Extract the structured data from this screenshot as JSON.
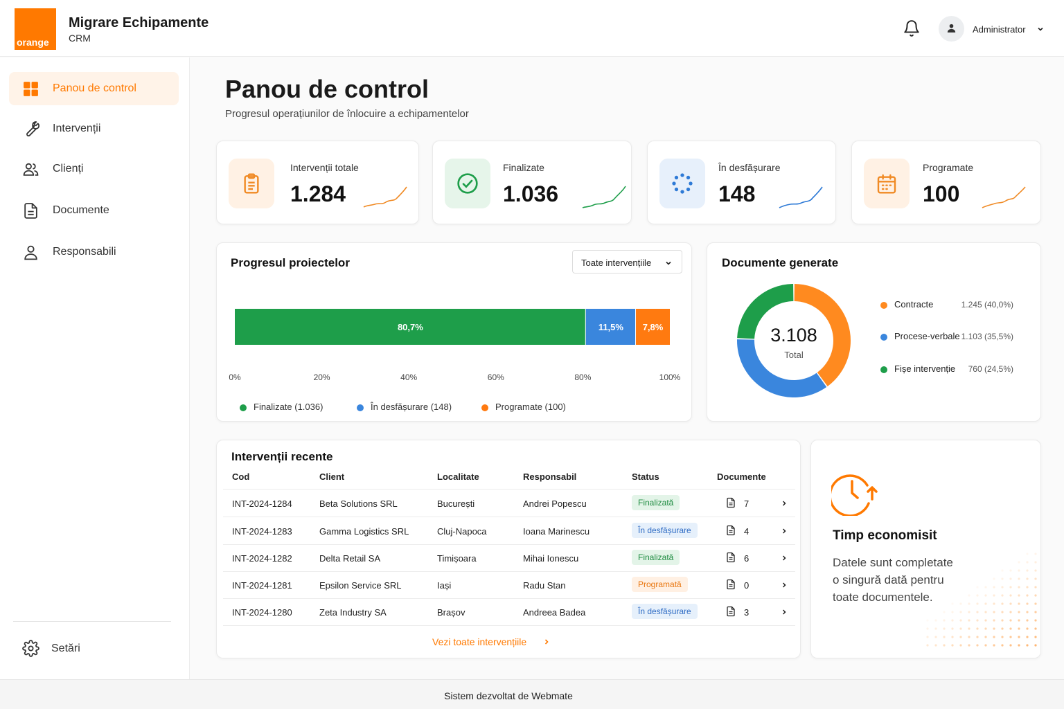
{
  "brand": {
    "logo_text": "orange",
    "title": "Migrare Echipamente",
    "subtitle": "CRM",
    "color": "#ff7900"
  },
  "header": {
    "user_name": "Administrator"
  },
  "sidebar": {
    "items": [
      {
        "label": "Panou de control",
        "icon": "dashboard-icon",
        "active": true
      },
      {
        "label": "Intervenții",
        "icon": "wrench-icon"
      },
      {
        "label": "Clienți",
        "icon": "users-icon"
      },
      {
        "label": "Documente",
        "icon": "document-icon"
      },
      {
        "label": "Responsabili",
        "icon": "user-icon"
      }
    ],
    "settings_label": "Setări"
  },
  "page": {
    "title": "Panou de control",
    "subtitle": "Progresul operațiunilor de înlocuire a echipamentelor"
  },
  "kpis": [
    {
      "label": "Intervenții totale",
      "value": "1.284",
      "icon": "clipboard-icon",
      "color": "#f08a24"
    },
    {
      "label": "Finalizate",
      "value": "1.036",
      "icon": "check-circle-icon",
      "color": "#1e9e4a"
    },
    {
      "label": "În desfășurare",
      "value": "148",
      "icon": "loader-icon",
      "color": "#2e7ad6"
    },
    {
      "label": "Programate",
      "value": "100",
      "icon": "calendar-icon",
      "color": "#f08a24"
    }
  ],
  "progress": {
    "title": "Progresul proiectelor",
    "filter": "Toate intervențiile",
    "chart_data": {
      "type": "bar",
      "orientation": "horizontal-stacked",
      "series": [
        {
          "name": "Finalizate (1.036)",
          "value": 80.7,
          "label": "80,7%",
          "color": "#1e9e4a"
        },
        {
          "name": "În desfășurare (148)",
          "value": 11.5,
          "label": "11,5%",
          "color": "#3a86dd"
        },
        {
          "name": "Programate (100)",
          "value": 7.8,
          "label": "7,8%",
          "color": "#ff7a10"
        }
      ],
      "xlim": [
        0,
        100
      ],
      "ticks": [
        "0%",
        "20%",
        "40%",
        "60%",
        "80%",
        "100%"
      ],
      "legend": "bottom"
    }
  },
  "documents": {
    "title": "Documente generate",
    "total_value": "3.108",
    "total_label": "Total",
    "chart_data": {
      "type": "pie",
      "donut": true,
      "slices": [
        {
          "name": "Contracte",
          "value": 1245,
          "label": "1.245 (40,0%)",
          "color": "#ff8a1f"
        },
        {
          "name": "Procese-verbale",
          "value": 1103,
          "label": "1.103 (35,5%)",
          "color": "#3a86dd"
        },
        {
          "name": "Fișe intervenție",
          "value": 760,
          "label": "760 (24,5%)",
          "color": "#1e9e4a"
        }
      ],
      "legend": "right"
    }
  },
  "recent": {
    "title": "Intervenții recente",
    "columns": [
      "Cod",
      "Client",
      "Localitate",
      "Responsabil",
      "Status",
      "Documente"
    ],
    "rows": [
      {
        "code": "INT-2024-1284",
        "client": "Beta Solutions SRL",
        "city": "București",
        "owner": "Andrei Popescu",
        "status": "Finalizată",
        "status_type": "fin",
        "docs": "7"
      },
      {
        "code": "INT-2024-1283",
        "client": "Gamma Logistics SRL",
        "city": "Cluj-Napoca",
        "owner": "Ioana Marinescu",
        "status": "În desfășurare",
        "status_type": "des",
        "docs": "4"
      },
      {
        "code": "INT-2024-1282",
        "client": "Delta Retail SA",
        "city": "Timișoara",
        "owner": "Mihai Ionescu",
        "status": "Finalizată",
        "status_type": "fin",
        "docs": "6"
      },
      {
        "code": "INT-2024-1281",
        "client": "Epsilon Service SRL",
        "city": "Iași",
        "owner": "Radu Stan",
        "status": "Programată",
        "status_type": "prg",
        "docs": "0"
      },
      {
        "code": "INT-2024-1280",
        "client": "Zeta Industry SA",
        "city": "Brașov",
        "owner": "Andreea Badea",
        "status": "În desfășurare",
        "status_type": "des",
        "docs": "3"
      }
    ],
    "see_all": "Vezi toate intervențiile"
  },
  "info": {
    "title": "Timp economisit",
    "lines": [
      "Datele sunt completate",
      "o singură dată pentru",
      "toate documentele."
    ],
    "icon": "clock-arrow-icon"
  },
  "footer": {
    "text": "Sistem dezvoltat de Webmate"
  }
}
